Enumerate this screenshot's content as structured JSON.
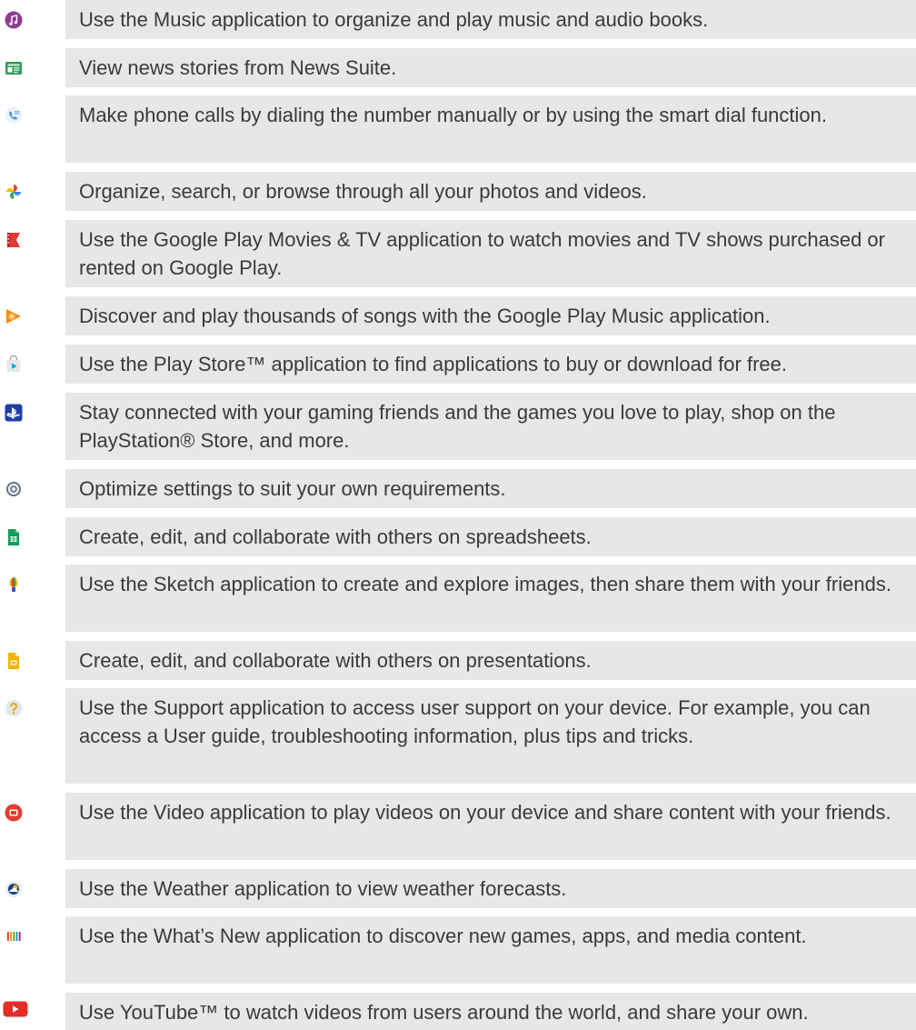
{
  "rows": [
    {
      "icon": "music-icon",
      "text": "Use the Music application to organize and play music and audio books."
    },
    {
      "icon": "news-icon",
      "text": "View news stories from News Suite."
    },
    {
      "icon": "phone-icon",
      "text": "Make phone calls by dialing the number manually or by using the smart dial function."
    },
    {
      "icon": "photos-icon",
      "text": "Organize, search, or browse through all your photos and videos."
    },
    {
      "icon": "play-movies-icon",
      "text": "Use the Google Play Movies & TV application to watch movies and TV shows purchased or rented on Google Play."
    },
    {
      "icon": "play-music-icon",
      "text": "Discover and play thousands of songs with the Google Play Music application."
    },
    {
      "icon": "play-store-icon",
      "text": "Use the Play Store™ application to find applications to buy or download for free."
    },
    {
      "icon": "playstation-icon",
      "text": "Stay connected with your gaming friends and the games you love to play, shop on the PlayStation® Store, and more."
    },
    {
      "icon": "settings-icon",
      "text": "Optimize settings to suit your own requirements."
    },
    {
      "icon": "sheets-icon",
      "text": "Create, edit, and collaborate with others on spreadsheets."
    },
    {
      "icon": "sketch-icon",
      "text": "Use the Sketch application to create and explore images, then share them with your friends."
    },
    {
      "icon": "slides-icon",
      "text": "Create, edit, and collaborate with others on presentations."
    },
    {
      "icon": "support-icon",
      "text": "Use the Support application to access user support on your device. For example, you can access a User guide, troubleshooting information, plus tips and tricks."
    },
    {
      "icon": "video-icon",
      "text": "Use the Video application to play videos on your device and share content with your friends."
    },
    {
      "icon": "weather-icon",
      "text": "Use the Weather application to view weather forecasts."
    },
    {
      "icon": "whats-new-icon",
      "text": "Use the What’s New application to discover new games, apps, and media content."
    },
    {
      "icon": "youtube-icon",
      "text": "Use YouTube™ to watch videos from users around the world, and share your own."
    }
  ]
}
